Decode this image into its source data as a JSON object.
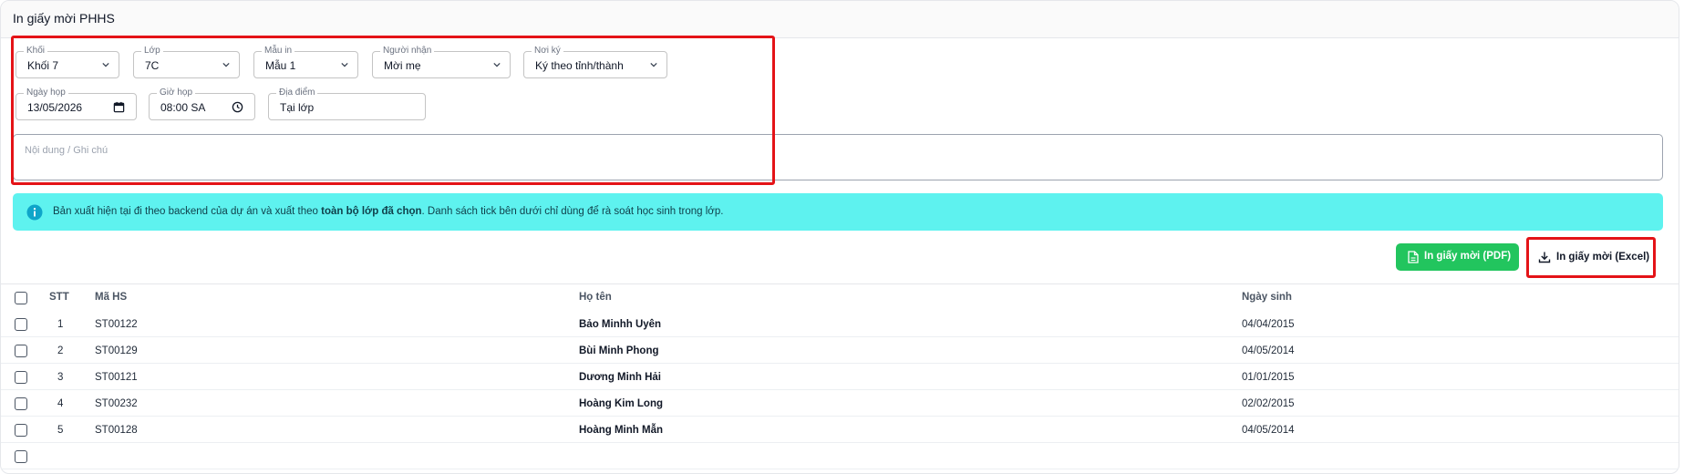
{
  "card": {
    "title": "In giấy mời PHHS"
  },
  "filters": {
    "khoi": {
      "label": "Khối",
      "value": "Khối 7"
    },
    "lop": {
      "label": "Lớp",
      "value": "7C"
    },
    "mau_in": {
      "label": "Mẫu in",
      "value": "Mẫu 1"
    },
    "nguoi_nhan": {
      "label": "Người nhận",
      "value": "Mời mẹ"
    },
    "noi_ky": {
      "label": "Nơi ký",
      "value": "Ký theo tỉnh/thành"
    },
    "ngay_hop": {
      "label": "Ngày họp",
      "value": "13/05/2026"
    },
    "gio_hop": {
      "label": "Giờ họp",
      "value": "08:00 SA"
    },
    "dia_diem": {
      "label": "Địa điểm",
      "value": "Tại lớp"
    }
  },
  "notes": {
    "placeholder": "Nội dung / Ghi chú"
  },
  "alert": {
    "text_before": "Bản xuất hiện tại đi theo backend của dự án và xuất theo ",
    "text_bold": "toàn bộ lớp đã chọn",
    "text_after": ". Danh sách tick bên dưới chỉ dùng để rà soát học sinh trong lớp."
  },
  "actions": {
    "pdf_label": "In giấy mời (PDF)",
    "excel_label": "In giấy mời (Excel)"
  },
  "table": {
    "headers": {
      "stt": "STT",
      "ma_hs": "Mã HS",
      "ho_ten": "Họ tên",
      "ngay_sinh": "Ngày sinh"
    },
    "rows": [
      {
        "stt": "1",
        "ma_hs": "ST00122",
        "ho_ten": "Bảo Minhh Uyên",
        "ngay_sinh": "04/04/2015"
      },
      {
        "stt": "2",
        "ma_hs": "ST00129",
        "ho_ten": "Bùi Minh Phong",
        "ngay_sinh": "04/05/2014"
      },
      {
        "stt": "3",
        "ma_hs": "ST00121",
        "ho_ten": "Dương Minh Hải",
        "ngay_sinh": "01/01/2015"
      },
      {
        "stt": "4",
        "ma_hs": "ST00232",
        "ho_ten": "Hoàng Kim Long",
        "ngay_sinh": "02/02/2015"
      },
      {
        "stt": "5",
        "ma_hs": "ST00128",
        "ho_ten": "Hoàng Minh Mẫn",
        "ngay_sinh": "04/05/2014"
      }
    ]
  },
  "colors": {
    "highlight_border": "#e41317",
    "alert_bg": "#5ef2ef",
    "pdf_button_bg": "#22c55e"
  },
  "icons": {
    "select": "chevron-down-icon",
    "date": "calendar-icon",
    "time": "clock-icon",
    "alert": "info-icon",
    "pdf": "file-icon",
    "excel": "download-icon"
  }
}
